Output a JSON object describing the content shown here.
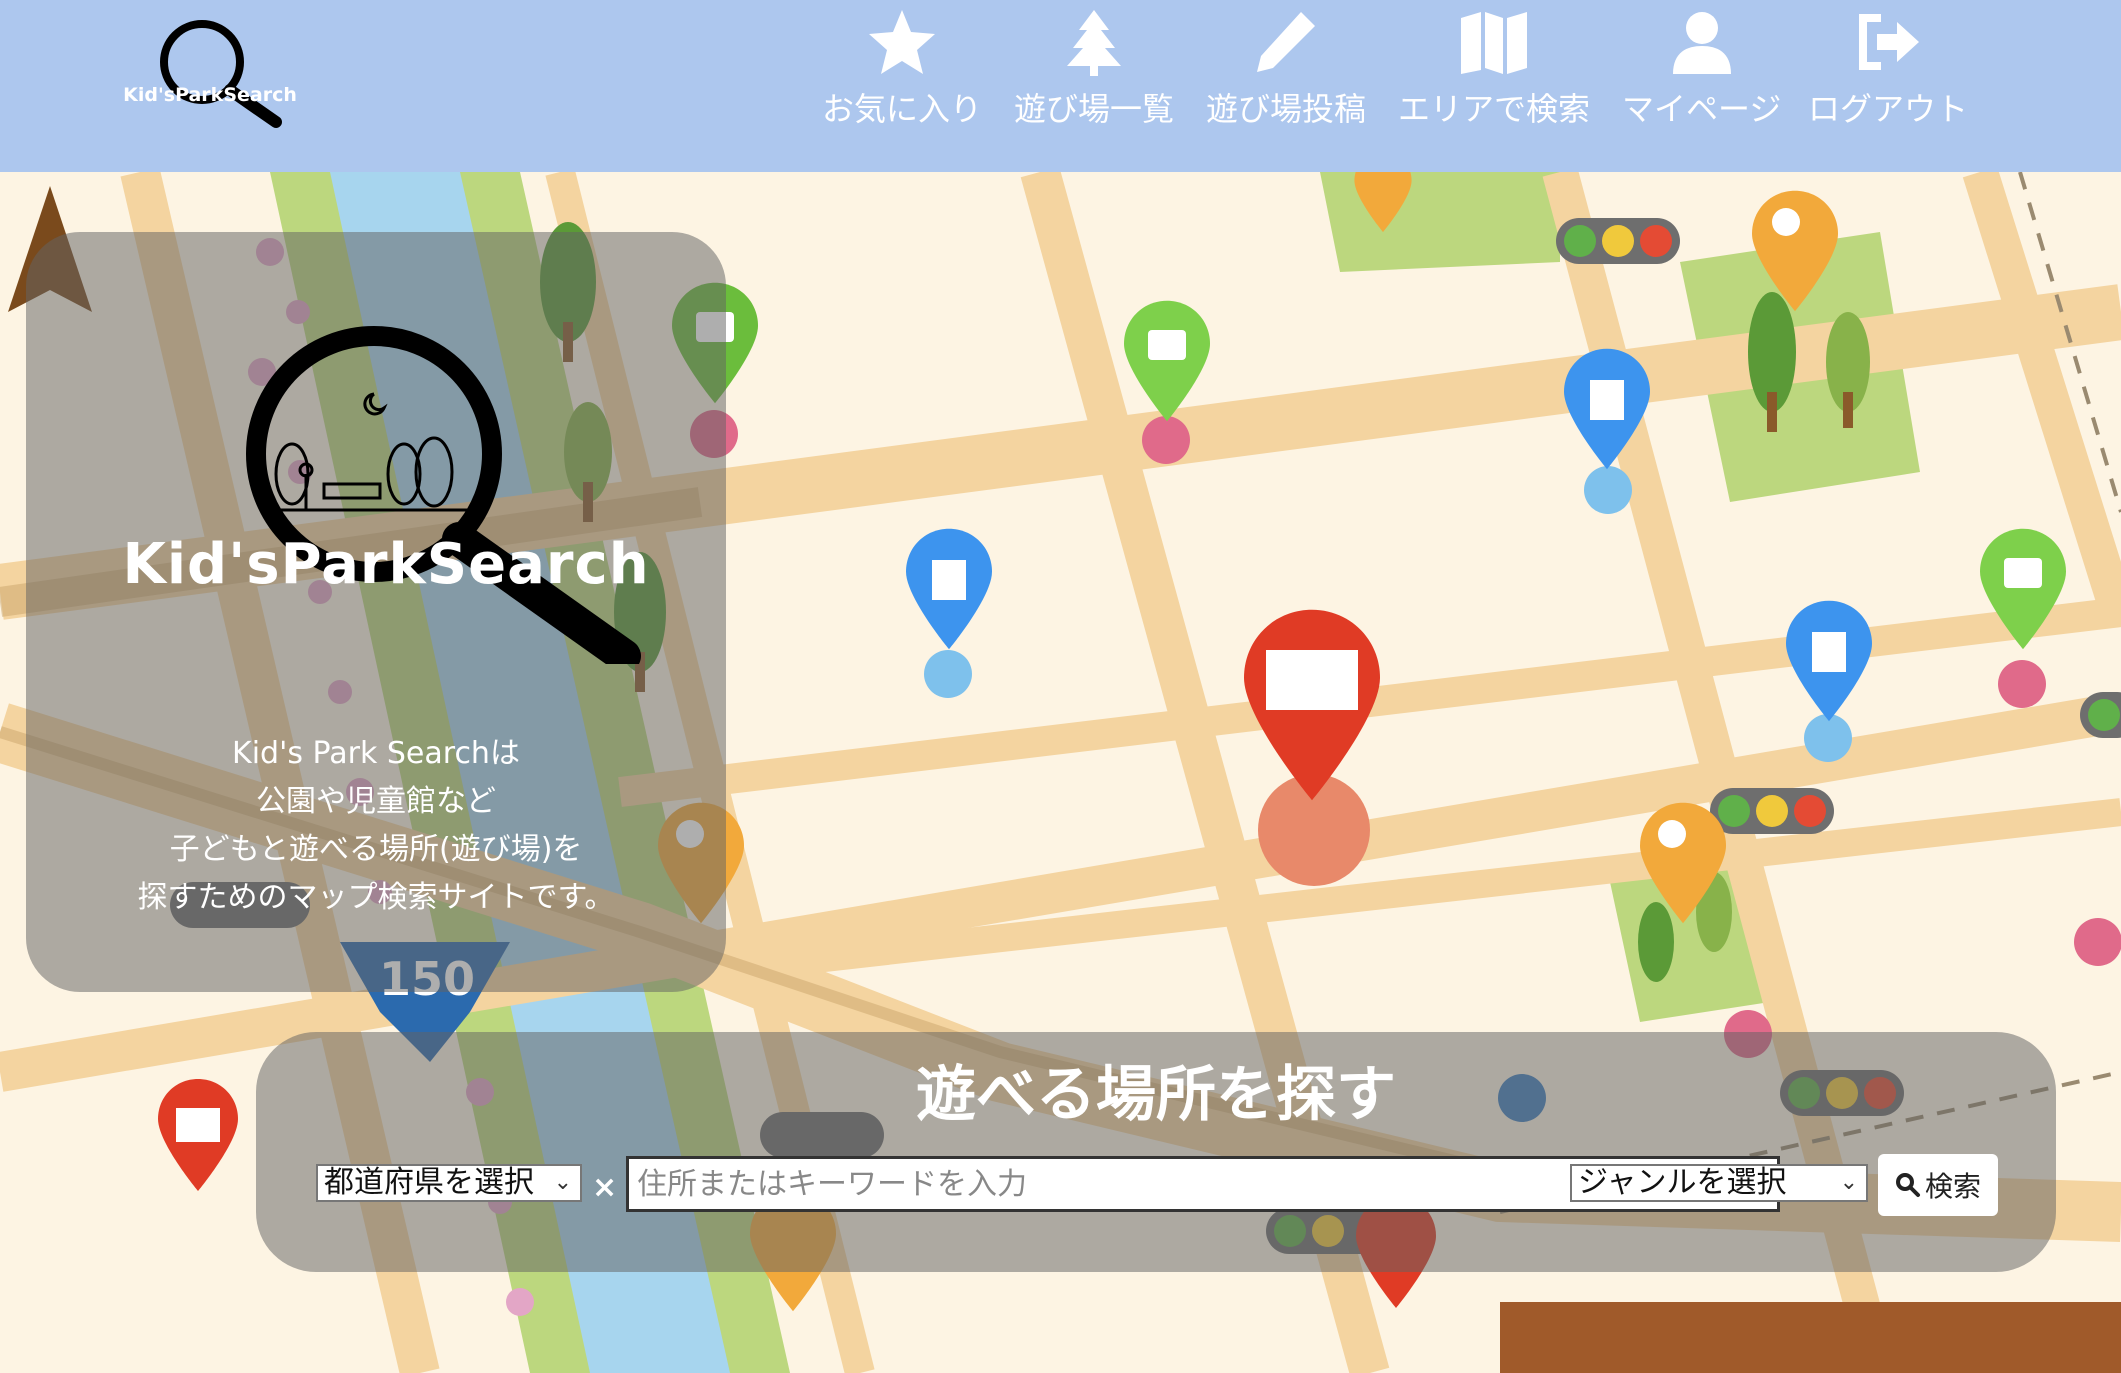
{
  "app": {
    "logo_text": "Kid'sParkSearch"
  },
  "nav": {
    "items": [
      {
        "label": "お気に入り",
        "icon": "star-icon"
      },
      {
        "label": "遊び場一覧",
        "icon": "tree-icon"
      },
      {
        "label": "遊び場投稿",
        "icon": "pencil-icon"
      },
      {
        "label": "エリアで検索",
        "icon": "map-icon"
      },
      {
        "label": "マイページ",
        "icon": "user-icon"
      },
      {
        "label": "ログアウト",
        "icon": "logout-icon"
      }
    ]
  },
  "hero": {
    "title": "Kid'sParkSearch",
    "desc_lines": [
      "Kid's Park Searchは",
      "公園や児童館など",
      "子どもと遊べる場所(遊び場)を",
      "探すためのマップ検索サイトです。"
    ]
  },
  "map": {
    "road_sign": "150"
  },
  "search": {
    "title": "遊べる場所を探す",
    "prefecture_select": "都道府県を選択",
    "separator": "×",
    "keyword_placeholder": "住所またはキーワードを入力",
    "genre_select": "ジャンルを選択",
    "button_label": "検索",
    "button_icon": "search-icon"
  },
  "colors": {
    "header_bg": "#adc7ee",
    "map_bg": "#fdf4e3",
    "road": "#f4d4a0",
    "river": "#a7d5ee",
    "park": "#bcd77e",
    "pin_green": "#7ed04b",
    "pin_blue": "#3d94ee",
    "pin_orange": "#f2a93b",
    "pin_red": "#e03b25"
  }
}
